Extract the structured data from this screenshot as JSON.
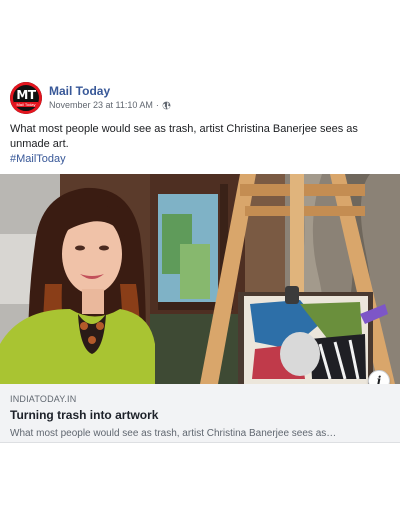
{
  "post": {
    "page_name": "Mail Today",
    "avatar": {
      "logo_text": "MT",
      "logo_subtext": "Mail Today"
    },
    "timestamp": "November 23 at 11:10 AM",
    "separator": "·",
    "privacy_icon": "globe-icon",
    "text": "What most people would see as trash, artist Christina Banerjee sees as unmade art.",
    "hashtag": "#MailToday"
  },
  "link_preview": {
    "domain": "INDIATODAY.IN",
    "title": "Turning trash into artwork",
    "description": "What most people would see as trash, artist Christina Banerjee sees as…",
    "info_icon": "info-icon",
    "info_label": "i"
  },
  "colors": {
    "link_blue": "#385898",
    "meta_gray": "#616770",
    "card_bg": "#f2f3f5",
    "brand_red": "#e4151f"
  }
}
